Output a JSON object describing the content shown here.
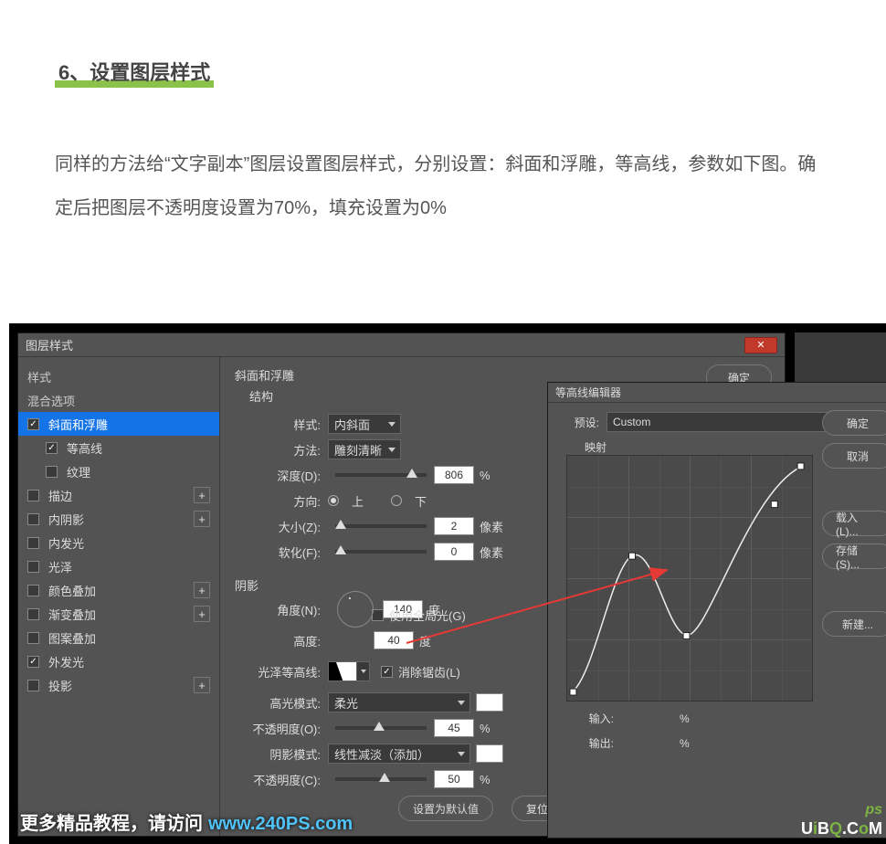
{
  "article": {
    "step_title": "6、设置图层样式",
    "paragraph": "同样的方法给“文字副本”图层设置图层样式，分别设置：斜面和浮雕，等高线，参数如下图。确定后把图层不透明度设置为70%，填充设置为0%"
  },
  "layer_style": {
    "title": "图层样式",
    "left": {
      "styles_header": "样式",
      "blend_header": "混合选项",
      "items": [
        {
          "label": "斜面和浮雕",
          "checked": true,
          "selected": true,
          "plus": false
        },
        {
          "label": "等高线",
          "checked": true,
          "sub": true,
          "plus": false
        },
        {
          "label": "纹理",
          "checked": false,
          "sub": true,
          "plus": false
        },
        {
          "label": "描边",
          "checked": false,
          "plus": true
        },
        {
          "label": "内阴影",
          "checked": false,
          "plus": true
        },
        {
          "label": "内发光",
          "checked": false,
          "plus": false
        },
        {
          "label": "光泽",
          "checked": false,
          "plus": false
        },
        {
          "label": "颜色叠加",
          "checked": false,
          "plus": true
        },
        {
          "label": "渐变叠加",
          "checked": false,
          "plus": true
        },
        {
          "label": "图案叠加",
          "checked": false,
          "plus": false
        },
        {
          "label": "外发光",
          "checked": true,
          "plus": false
        },
        {
          "label": "投影",
          "checked": false,
          "plus": true
        }
      ]
    },
    "bevel": {
      "title": "斜面和浮雕",
      "structure_label": "结构",
      "style_label": "样式:",
      "style_value": "内斜面",
      "technique_label": "方法:",
      "technique_value": "雕刻清晰",
      "depth_label": "深度(D):",
      "depth_value": "806",
      "percent": "%",
      "direction_label": "方向:",
      "direction_up": "上",
      "direction_down": "下",
      "size_label": "大小(Z):",
      "size_value": "2",
      "px": "像素",
      "soften_label": "软化(F):",
      "soften_value": "0"
    },
    "shading": {
      "title": "阴影",
      "angle_label": "角度(N):",
      "angle_value": "140",
      "degree": "度",
      "global_light": "使用全局光(G)",
      "altitude_label": "高度:",
      "altitude_value": "40",
      "gloss_contour_label": "光泽等高线:",
      "antialias": "消除锯齿(L)",
      "highlight_mode_label": "高光模式:",
      "highlight_mode_value": "柔光",
      "highlight_opacity_label": "不透明度(O):",
      "highlight_opacity_value": "45",
      "shadow_mode_label": "阴影模式:",
      "shadow_mode_value": "线性减淡（添加）",
      "shadow_opacity_label": "不透明度(C):",
      "shadow_opacity_value": "50"
    },
    "buttons": {
      "make_default": "设置为默认值",
      "reset_default": "复位为默认值",
      "ok": "确定"
    }
  },
  "contour_editor": {
    "title": "等高线编辑器",
    "preset_label": "预设:",
    "preset_value": "Custom",
    "mapping_label": "映射",
    "input_label": "输入:",
    "output_label": "输出:",
    "percent": "%",
    "buttons": {
      "ok": "确定",
      "cancel": "取消",
      "load": "载入(L)...",
      "save": "存储(S)...",
      "new": "新建..."
    }
  },
  "watermark": {
    "text": "更多精品教程，请访问",
    "url": "www.240PS.com",
    "ps_tag": "ps",
    "uibq": "UiBQ.CoM"
  }
}
